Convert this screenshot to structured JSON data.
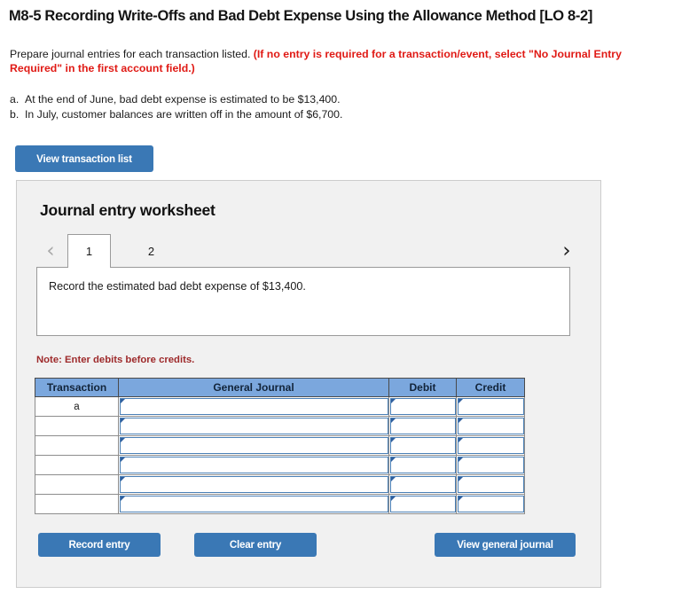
{
  "problem": {
    "title": "M8-5 Recording Write-Offs and Bad Debt Expense Using the Allowance Method [LO 8-2]",
    "instruction_lead": "Prepare journal entries for each transaction listed. ",
    "instruction_required": "(If no entry is required for a transaction/event, select \"No Journal Entry Required\" in the first account field.)",
    "items": [
      {
        "label": "a.",
        "text": "At the end of June, bad debt expense is estimated to be $13,400."
      },
      {
        "label": "b.",
        "text": "In July, customer balances are written off in the amount of $6,700."
      }
    ]
  },
  "toolbar": {
    "view_transaction_list_label": "View transaction list"
  },
  "worksheet": {
    "title": "Journal entry worksheet",
    "prev_arrow": "‹",
    "next_arrow": "›",
    "tabs": [
      {
        "label": "1",
        "active": true
      },
      {
        "label": "2",
        "active": false
      }
    ],
    "scenario_text": "Record the estimated bad debt expense of $13,400.",
    "note": "Note: Enter debits before credits.",
    "table": {
      "headers": [
        "Transaction",
        "General Journal",
        "Debit",
        "Credit"
      ],
      "rows": [
        {
          "transaction": "a",
          "general_journal": "",
          "debit": "",
          "credit": ""
        },
        {
          "transaction": "",
          "general_journal": "",
          "debit": "",
          "credit": ""
        },
        {
          "transaction": "",
          "general_journal": "",
          "debit": "",
          "credit": ""
        },
        {
          "transaction": "",
          "general_journal": "",
          "debit": "",
          "credit": ""
        },
        {
          "transaction": "",
          "general_journal": "",
          "debit": "",
          "credit": ""
        },
        {
          "transaction": "",
          "general_journal": "",
          "debit": "",
          "credit": ""
        }
      ]
    },
    "actions": {
      "record_entry_label": "Record entry",
      "clear_entry_label": "Clear entry",
      "view_general_journal_label": "View general journal"
    }
  },
  "colors": {
    "button_blue": "#3a78b5",
    "table_header_blue": "#7ba7dd",
    "required_red": "#e01a15",
    "note_red": "#9e2a2b",
    "panel_grey": "#f1f1f1"
  }
}
